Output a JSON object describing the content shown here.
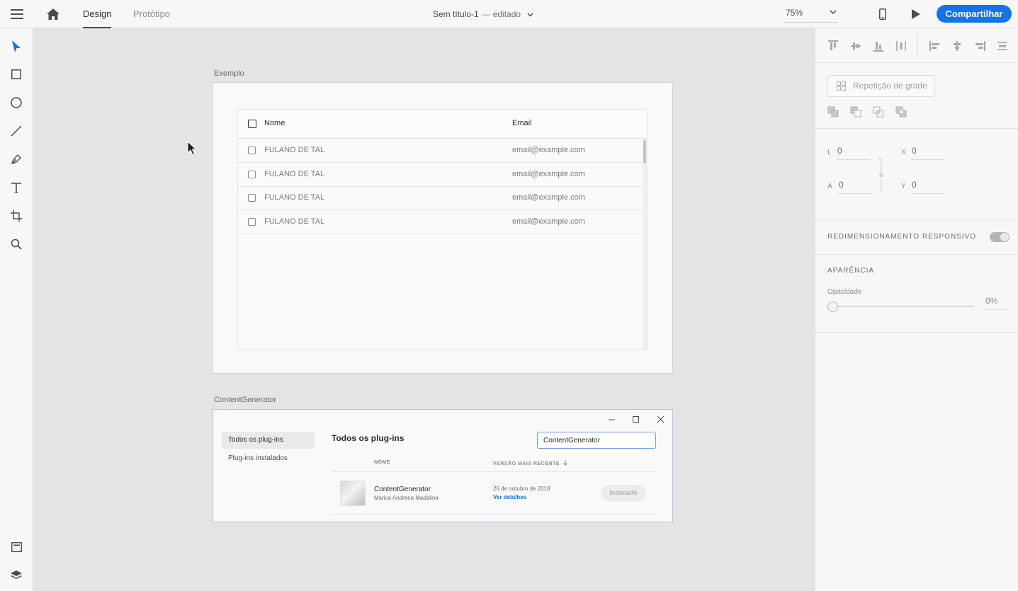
{
  "topbar": {
    "tabs": [
      {
        "label": "Design",
        "active": true
      },
      {
        "label": "Protótipo",
        "active": false
      }
    ],
    "document": {
      "title": "Sem título-1",
      "separator": "—",
      "state": "editado"
    },
    "zoom": "75%",
    "share_label": "Compartilhar",
    "icons": [
      "hamburger-menu-icon",
      "home-icon",
      "chevron-down-icon",
      "mobile-device-icon",
      "play-icon"
    ]
  },
  "tools": [
    "select-arrow-icon",
    "rectangle-icon",
    "ellipse-icon",
    "line-icon",
    "pen-icon",
    "text-icon",
    "artboard-icon",
    "zoom-icon",
    "assets-icon",
    "layers-icon"
  ],
  "canvas": {
    "artboard1": {
      "label": "Exemplo",
      "table": {
        "headers": [
          "Nome",
          "Email"
        ],
        "rows": [
          {
            "name": "FULANO DE TAL",
            "email": "email@example.com"
          },
          {
            "name": "FULANO DE TAL",
            "email": "email@example.com"
          },
          {
            "name": "FULANO DE TAL",
            "email": "email@example.com"
          },
          {
            "name": "FULANO DE TAL",
            "email": "email@example.com"
          }
        ]
      }
    },
    "artboard2": {
      "label": "ContentGenerator",
      "nav": [
        "Todos os plug-ins",
        "Plug-ins instalados"
      ],
      "title": "Todos os plug-ins",
      "search_value": "ContentGenerator",
      "columns": {
        "name": "NOME",
        "version": "VERSÃO MAIS RECENTE"
      },
      "plugin": {
        "name": "ContentGenerator",
        "author": "Marica Andreea Madalina",
        "date": "26 de outubro de 2018",
        "link": "Ver detalhes",
        "status": "Instalado"
      }
    }
  },
  "rightpanel": {
    "repeat_grid": "Repetição de grade",
    "fields": {
      "w_label": "L",
      "w_value": "0",
      "x_label": "X",
      "x_value": "0",
      "h_label": "A",
      "h_value": "0",
      "y_label": "Y",
      "y_value": "0"
    },
    "responsive_resize": "REDIMENSIONAMENTO RESPONSIVO",
    "appearance": "APARÊNCIA",
    "opacity_label": "Opacidade",
    "opacity_value": "0%"
  },
  "colors": {
    "accent": "#1473e6",
    "canvas": "#e4e4e4",
    "panel": "#f7f7f7"
  }
}
